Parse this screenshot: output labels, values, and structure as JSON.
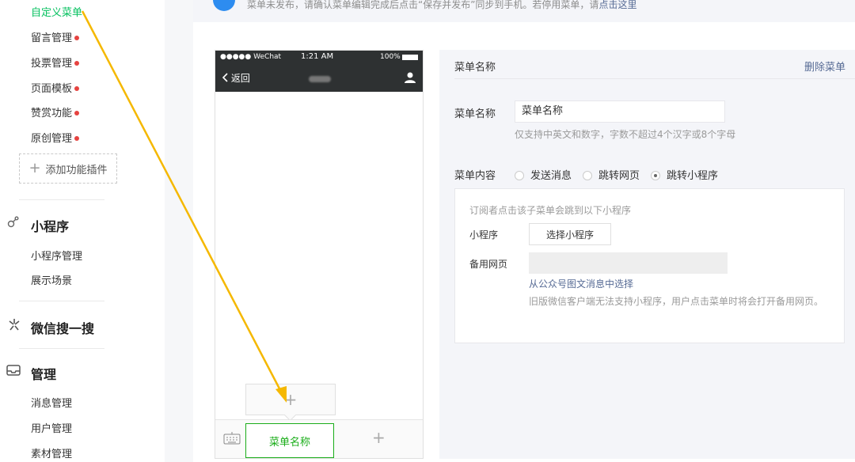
{
  "sidebar": {
    "active_item": "自定义菜单",
    "function_items": [
      "留言管理",
      "投票管理",
      "页面模板",
      "赞赏功能",
      "原创管理"
    ],
    "add_plugin": "添加功能插件",
    "mini_program": {
      "title": "小程序",
      "items": [
        "小程序管理",
        "展示场景"
      ]
    },
    "search": {
      "title": "微信搜一搜"
    },
    "manage": {
      "title": "管理",
      "items": [
        "消息管理",
        "用户管理",
        "素材管理"
      ]
    }
  },
  "notice": {
    "text": "菜单未发布，请确认菜单编辑完成后点击“保存并发布”同步到手机。若停用菜单，请",
    "link": "点击这里"
  },
  "phone": {
    "carrier": "●●●●● WeChat",
    "time": "1:21 AM",
    "battery": "100%",
    "back_label": "返回",
    "menu_button": "菜单名称"
  },
  "editor": {
    "title": "菜单名称",
    "delete_label": "删除菜单",
    "name_label": "菜单名称",
    "name_value": "菜单名称",
    "name_hint": "仅支持中英文和数字，字数不超过4个汉字或8个字母",
    "content_label": "菜单内容",
    "options": [
      "发送消息",
      "跳转网页",
      "跳转小程序"
    ],
    "selected_option": "跳转小程序",
    "panel": {
      "hint": "订阅者点击该子菜单会跳到以下小程序",
      "mini_label": "小程序",
      "select_button": "选择小程序",
      "backup_label": "备用网页",
      "link": "从公众号图文消息中选择",
      "note": "旧版微信客户端无法支持小程序，用户点击菜单时将会打开备用网页。"
    }
  },
  "colors": {
    "active": "#07c160",
    "menu_green": "#1aad19",
    "arrow": "#f5b800",
    "link": "#576b95"
  }
}
